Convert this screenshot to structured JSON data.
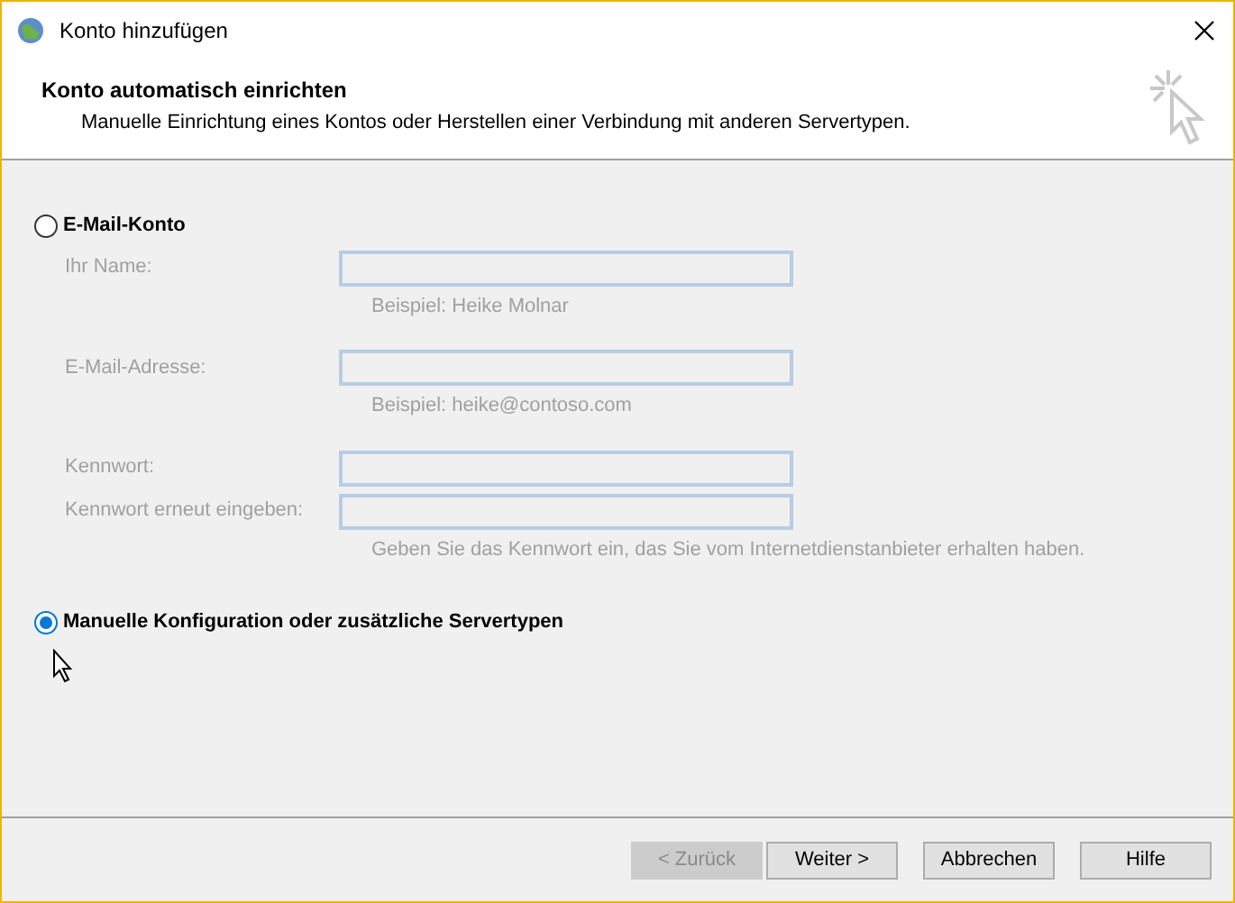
{
  "window": {
    "title": "Konto hinzufügen"
  },
  "header": {
    "title": "Konto automatisch einrichten",
    "description": "Manuelle Einrichtung eines Kontos oder Herstellen einer Verbindung mit anderen Servertypen."
  },
  "options": [
    {
      "label": "E-Mail-Konto",
      "selected": false,
      "fields": [
        {
          "label": "Ihr Name:",
          "disabled": true,
          "hint": "Beispiel: Heike Molnar"
        },
        {
          "label": "E-Mail-Adresse:",
          "disabled": true,
          "hint": "Beispiel: heike@contoso.com"
        },
        {
          "label": "Kennwort:",
          "disabled": true
        },
        {
          "label": "Kennwort erneut eingeben:",
          "disabled": true,
          "hint": "Geben Sie das Kennwort ein, das Sie vom Internetdienstanbieter erhalten haben."
        }
      ]
    },
    {
      "label": "Manuelle Konfiguration oder zusätzliche Servertypen",
      "selected": true
    }
  ],
  "buttons": [
    {
      "label": "< Zurück",
      "disabled": true
    },
    {
      "label": "Weiter >",
      "disabled": false
    },
    {
      "label": "Abbrechen",
      "disabled": false
    },
    {
      "label": "Hilfe",
      "disabled": false
    }
  ]
}
